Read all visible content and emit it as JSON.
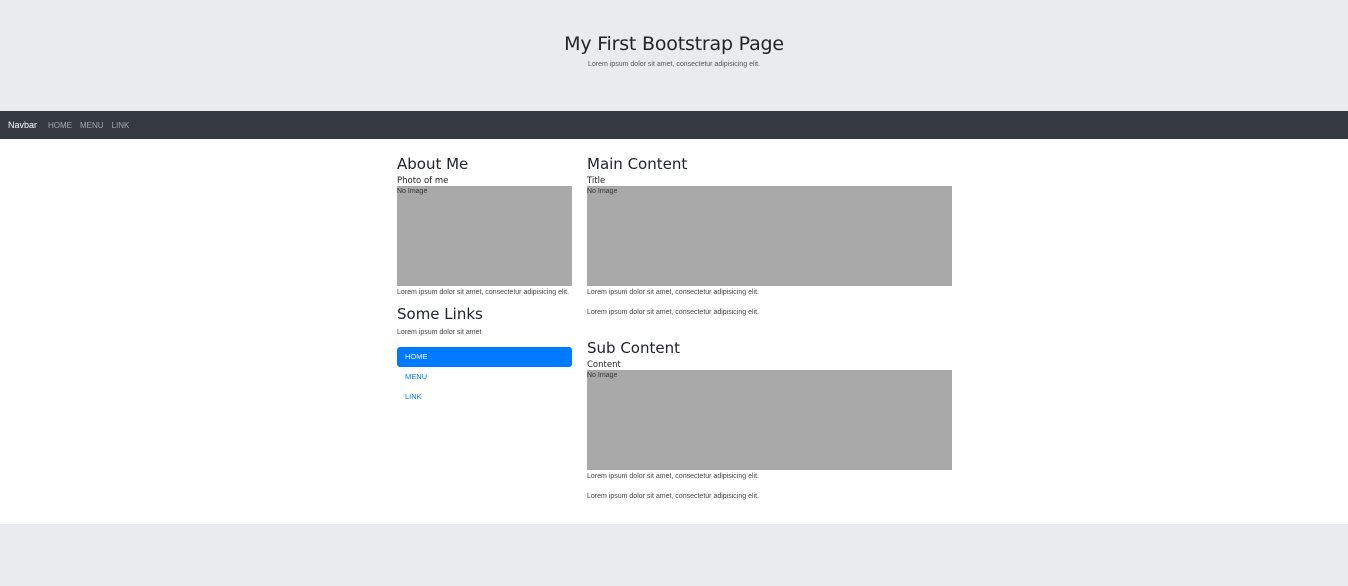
{
  "header": {
    "title": "My First Bootstrap Page",
    "subtitle": "Lorem ipsum dolor sit amet, consectetur adipisicing elit."
  },
  "navbar": {
    "brand": "Navbar",
    "links": [
      "HOME",
      "MENU",
      "LINK"
    ]
  },
  "sidebar": {
    "about_title": "About Me",
    "photo_label": "Photo of me",
    "image_placeholder": "No Image",
    "about_text": "Lorem ipsum dolor sit amet, consectetur adipisicing elit.",
    "links_title": "Some Links",
    "links_text": "Lorem ipsum dolor sit amet",
    "pills": [
      "HOME",
      "MENU",
      "LINK"
    ]
  },
  "main": {
    "title": "Main Content",
    "subtitle": "Title",
    "image_placeholder": "No Image",
    "text1": "Lorem ipsum dolor sit amet, consectetur adipisicing elit.",
    "text2": "Lorem ipsum dolor sit amet, consectetur adipisicing elit."
  },
  "sub": {
    "title": "Sub Content",
    "subtitle": "Content",
    "image_placeholder": "No Image",
    "text1": "Lorem ipsum dolor sit amet, consectetur adipisicing elit.",
    "text2": "Lorem ipsum dolor sit amet, consectetur adipisicing elit."
  },
  "colors": {
    "navbar_bg": "#343a40",
    "jumbotron_bg": "#e9ecef",
    "primary": "#007bff",
    "placeholder_bg": "#a9a9a9"
  }
}
